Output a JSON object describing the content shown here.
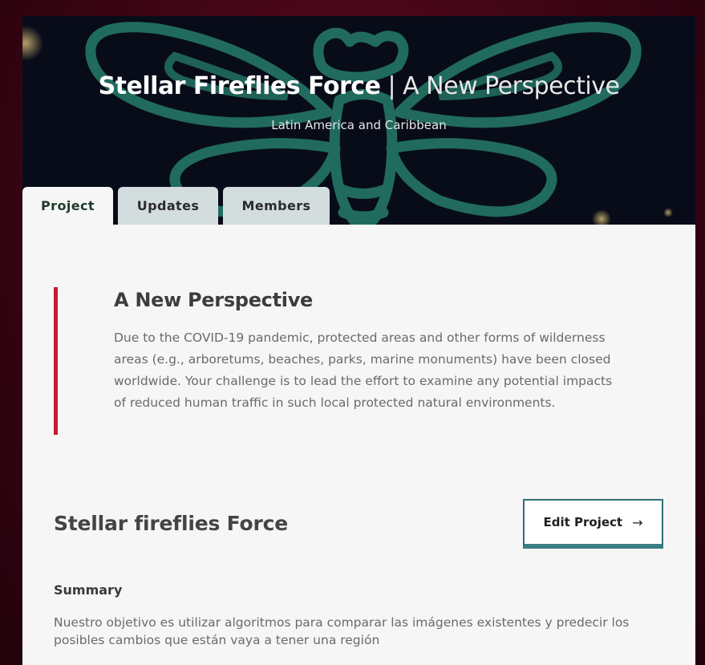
{
  "hero": {
    "team_name": "Stellar Fireflies Force",
    "separator": "|",
    "challenge_name": "A New Perspective",
    "region": "Latin America and Caribbean",
    "logo": "firefly-logo-icon"
  },
  "tabs": [
    {
      "label": "Project",
      "active": true
    },
    {
      "label": "Updates",
      "active": false
    },
    {
      "label": "Members",
      "active": false
    }
  ],
  "challenge": {
    "title": "A New Perspective",
    "description": "Due to the COVID-19 pandemic, protected areas and other forms of wilderness areas (e.g., arboretums, beaches, parks, marine monuments) have been closed worldwide. Your challenge is to lead the effort to examine any potential impacts of reduced human traffic in such local protected natural environments."
  },
  "project": {
    "name": "Stellar fireflies Force",
    "edit_label": "Edit Project",
    "edit_arrow": "→",
    "summary_label": "Summary",
    "summary_text": "Nuestro objetivo es utilizar algoritmos para comparar las imágenes existentes y predecir los posibles cambios que están vaya a tener una región"
  },
  "colors": {
    "accent_bar": "#c8183a",
    "button_border": "#2f6f74",
    "tab_inactive": "#d4dddd",
    "logo_stroke": "#2a8a78"
  }
}
